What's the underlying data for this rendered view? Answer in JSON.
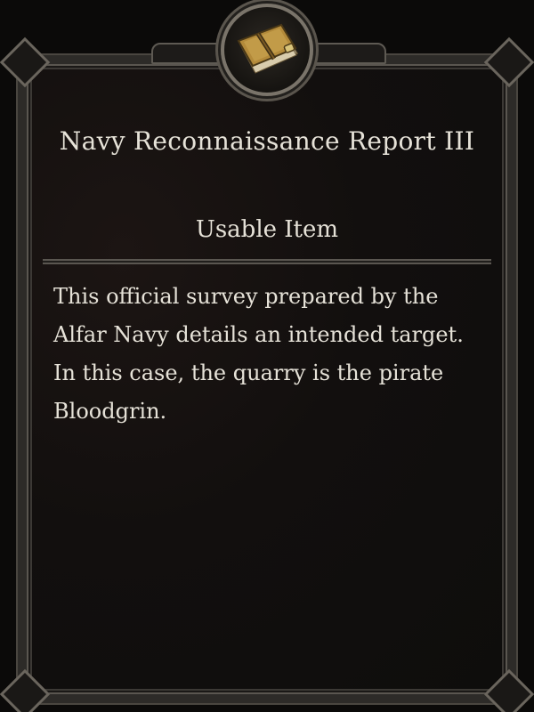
{
  "item": {
    "icon": "leather-journal-icon",
    "title": "Navy Reconnaissance Report III",
    "type": "Usable Item",
    "description": "This official survey prepared by the Alfar Navy details an intended target. In this case, the quarry is the pirate Bloodgrin."
  },
  "colors": {
    "text": "#e6e2d8",
    "background": "#0e0d0c",
    "frame": "#5a5650",
    "book_cover": "#b38a3a"
  }
}
